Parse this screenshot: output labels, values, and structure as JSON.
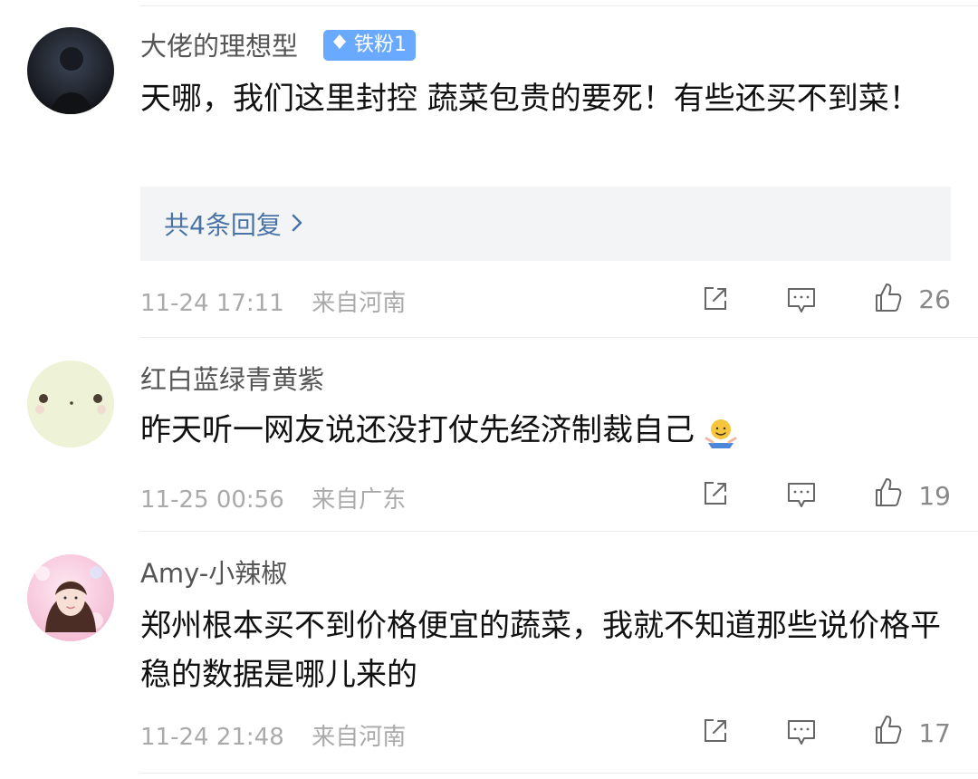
{
  "comments": [
    {
      "username": "大佬的理想型",
      "badge": "铁粉1",
      "text": "天哪，我们这里封控 蔬菜包贵的要死！有些还买不到菜！",
      "reply_summary": "共4条回复",
      "time": "11-24 17:11",
      "location": "来自河南",
      "likes": "26"
    },
    {
      "username": "红白蓝绿青黄紫",
      "text": "昨天听一网友说还没打仗先经济制裁自己",
      "time": "11-25 00:56",
      "location": "来自广东",
      "likes": "19"
    },
    {
      "username": "Amy-小辣椒",
      "text": "郑州根本买不到价格便宜的蔬菜，我就不知道那些说价格平稳的数据是哪儿来的",
      "time": "11-24 21:48",
      "location": "来自河南",
      "likes": "17"
    }
  ],
  "icons": {
    "share": "share-icon",
    "comment": "comment-icon",
    "like": "thumb-up-icon",
    "reply_arrow": "chevron-right-icon",
    "badge": "diamond-icon",
    "emoji": "shrug-emoji-icon"
  },
  "colors": {
    "username": "#555555",
    "text": "#111111",
    "meta": "#aaaaaa",
    "reply_link": "#4b74a6",
    "reply_bg": "#f3f4f6",
    "badge_bg": "#69a9ff"
  }
}
